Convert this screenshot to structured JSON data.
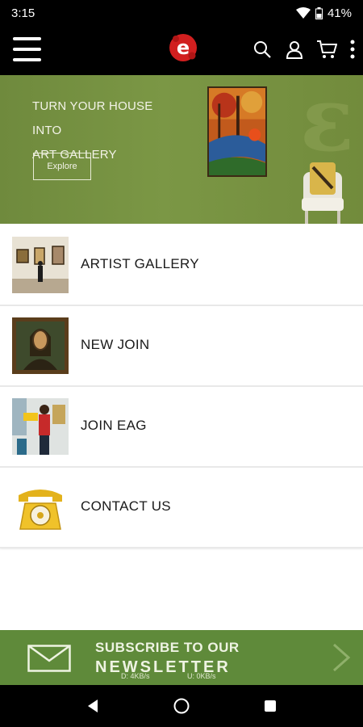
{
  "status": {
    "time": "3:15",
    "battery": "41%"
  },
  "appbar": {
    "logo_letter": "e",
    "icons": [
      "menu-icon",
      "search-icon",
      "account-icon",
      "cart-icon",
      "overflow-icon"
    ]
  },
  "banner": {
    "line1": "TURN YOUR HOUSE INTO",
    "line2": "ART GALLERY",
    "button": "Explore",
    "accent": "#7b9745"
  },
  "menu": {
    "items": [
      {
        "label": "ARTIST GALLERY"
      },
      {
        "label": "NEW JOIN"
      },
      {
        "label": "JOIN EAG"
      },
      {
        "label": "CONTACT US"
      }
    ]
  },
  "newsletter": {
    "line1": "SUBSCRIBE TO OUR",
    "line2": "NEWSLETTER",
    "down_speed": "D: 4KB/s",
    "up_speed": "U: 0KB/s",
    "color": "#5f8a3a"
  },
  "navbar": {
    "icons": [
      "back-icon",
      "home-icon",
      "recents-icon"
    ]
  }
}
